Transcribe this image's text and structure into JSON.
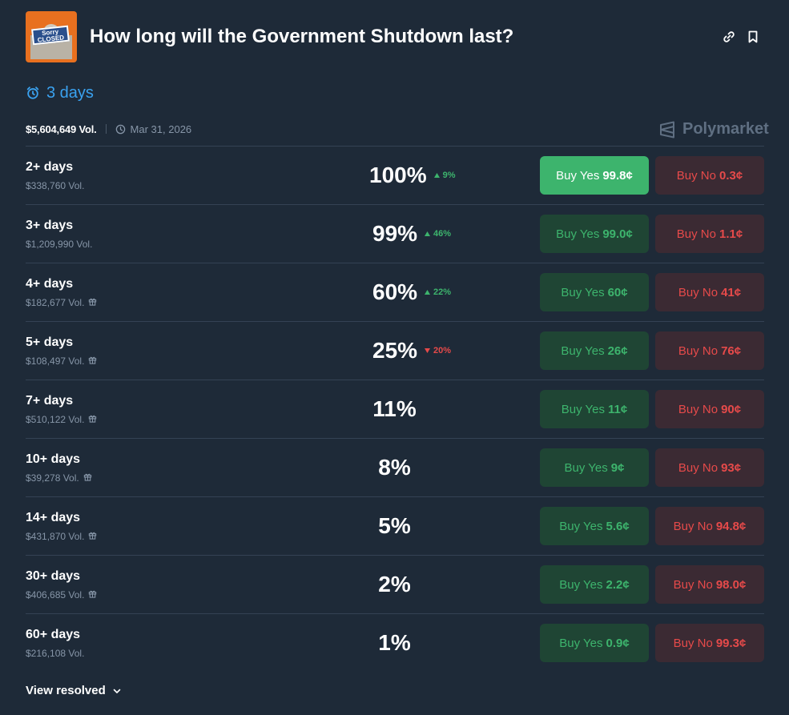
{
  "market": {
    "title": "How long will the Government Shutdown last?",
    "thumb_text_1": "Sorry",
    "thumb_text_2": "WE'RE",
    "thumb_text_3": "CLOSED"
  },
  "countdown": {
    "value": "3 days",
    "icon": "alarm-clock-icon"
  },
  "meta": {
    "volume": "$5,604,649 Vol.",
    "date": "Mar 31, 2026"
  },
  "brand": {
    "name": "Polymarket"
  },
  "outcomes": [
    {
      "label": "2+ days",
      "volume": "$338,760 Vol.",
      "gift": false,
      "pct": "100%",
      "change": "9%",
      "dir": "up",
      "yes": "99.8¢",
      "no": "0.3¢",
      "active": true
    },
    {
      "label": "3+ days",
      "volume": "$1,209,990 Vol.",
      "gift": false,
      "pct": "99%",
      "change": "46%",
      "dir": "up",
      "yes": "99.0¢",
      "no": "1.1¢",
      "active": false
    },
    {
      "label": "4+ days",
      "volume": "$182,677 Vol.",
      "gift": true,
      "pct": "60%",
      "change": "22%",
      "dir": "up",
      "yes": "60¢",
      "no": "41¢",
      "active": false
    },
    {
      "label": "5+ days",
      "volume": "$108,497 Vol.",
      "gift": true,
      "pct": "25%",
      "change": "20%",
      "dir": "down",
      "yes": "26¢",
      "no": "76¢",
      "active": false
    },
    {
      "label": "7+ days",
      "volume": "$510,122 Vol.",
      "gift": true,
      "pct": "11%",
      "change": "",
      "dir": "",
      "yes": "11¢",
      "no": "90¢",
      "active": false
    },
    {
      "label": "10+ days",
      "volume": "$39,278 Vol.",
      "gift": true,
      "pct": "8%",
      "change": "",
      "dir": "",
      "yes": "9¢",
      "no": "93¢",
      "active": false
    },
    {
      "label": "14+ days",
      "volume": "$431,870 Vol.",
      "gift": true,
      "pct": "5%",
      "change": "",
      "dir": "",
      "yes": "5.6¢",
      "no": "94.8¢",
      "active": false
    },
    {
      "label": "30+ days",
      "volume": "$406,685 Vol.",
      "gift": true,
      "pct": "2%",
      "change": "",
      "dir": "",
      "yes": "2.2¢",
      "no": "98.0¢",
      "active": false
    },
    {
      "label": "60+ days",
      "volume": "$216,108 Vol.",
      "gift": false,
      "pct": "1%",
      "change": "",
      "dir": "",
      "yes": "0.9¢",
      "no": "99.3¢",
      "active": false
    }
  ],
  "buttons": {
    "yes_label": "Buy Yes",
    "no_label": "Buy No"
  },
  "footer": {
    "view_resolved": "View resolved"
  },
  "colors": {
    "background": "#1e2a38",
    "accent_blue": "#3aa2f0",
    "green": "#3db46d",
    "red": "#e64a4a",
    "yes_bg": "#1f4534",
    "no_bg": "#3b2a33"
  }
}
